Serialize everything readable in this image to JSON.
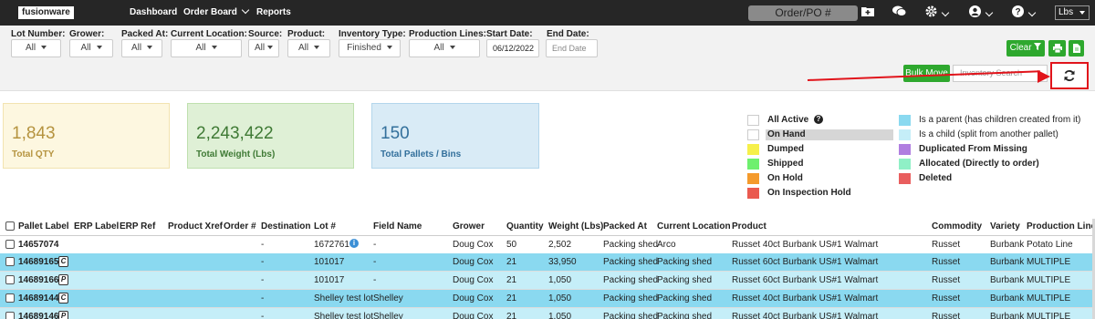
{
  "nav": {
    "logo": "fusionware",
    "links": [
      "Dashboard",
      "Order Board",
      "Reports"
    ],
    "order_po": "Order/PO #",
    "units": "Lbs"
  },
  "filters": {
    "lot_number": {
      "label": "Lot Number:",
      "value": "All"
    },
    "grower": {
      "label": "Grower:",
      "value": "All"
    },
    "packed_at": {
      "label": "Packed At:",
      "value": "All"
    },
    "current_location": {
      "label": "Current Location:",
      "value": "All"
    },
    "source": {
      "label": "Source:",
      "value": "All"
    },
    "product": {
      "label": "Product:",
      "value": "All"
    },
    "inventory_type": {
      "label": "Inventory Type:",
      "value": "Finished"
    },
    "production_lines": {
      "label": "Production Lines:",
      "value": "All"
    },
    "start_date": {
      "label": "Start Date:",
      "value": "06/12/2022"
    },
    "end_date": {
      "label": "End Date:",
      "placeholder": "End Date"
    },
    "clear": "Clear",
    "bulk_move": "Bulk Move",
    "search_placeholder": "Inventory Search"
  },
  "stats": [
    {
      "value": "1,843",
      "label": "Total QTY"
    },
    {
      "value": "2,243,422",
      "label": "Total Weight (Lbs)"
    },
    {
      "value": "150",
      "label": "Total Pallets / Bins"
    }
  ],
  "legend": {
    "left": [
      {
        "label": "All Active",
        "color": "#ffffff"
      },
      {
        "label": "On Hand",
        "color": "#ffffff"
      },
      {
        "label": "Dumped",
        "color": "#f6f04a"
      },
      {
        "label": "Shipped",
        "color": "#6ef06e"
      },
      {
        "label": "On Hold",
        "color": "#f49a2c"
      },
      {
        "label": "On Inspection Hold",
        "color": "#ea5a4f"
      }
    ],
    "right": [
      {
        "label": "Is a parent (has children created from it)",
        "color": "#8ad9f0"
      },
      {
        "label": "Is a child (split from another pallet)",
        "color": "#c5eef8"
      },
      {
        "label": "Duplicated From Missing",
        "color": "#b07ee0"
      },
      {
        "label": "Allocated (Directly to order)",
        "color": "#8ff0c6"
      },
      {
        "label": "Deleted",
        "color": "#e95e5e"
      }
    ]
  },
  "table": {
    "columns": [
      "Pallet Label",
      "ERP Label",
      "ERP Ref",
      "Product Xref",
      "Order #",
      "Destination",
      "Lot #",
      "Field Name",
      "Grower",
      "Quantity",
      "Weight (Lbs)",
      "Packed At",
      "Current Location",
      "Product",
      "Commodity",
      "Variety",
      "Production Line"
    ],
    "rows": [
      {
        "pallet": "14657074",
        "badge": "",
        "dest": "-",
        "lot": "1672761",
        "field": "-",
        "grower": "Doug Cox",
        "qty": "50",
        "weight": "2,502",
        "packed": "Packing shed",
        "location": "Arco",
        "product": "Russet 40ct Burbank US#1 Walmart",
        "commodity": "Russet",
        "variety": "Burbank",
        "line": "Potato Line",
        "color": "#ffffff"
      },
      {
        "pallet": "14689165",
        "badge": "C",
        "dest": "-",
        "lot": "101017",
        "field": "-",
        "grower": "Doug Cox",
        "qty": "21",
        "weight": "33,950",
        "packed": "Packing shed",
        "location": "Packing shed",
        "product": "Russet 60ct Burbank US#1 Walmart",
        "commodity": "Russet",
        "variety": "Burbank",
        "line": "MULTIPLE",
        "color": "#8ad9f0"
      },
      {
        "pallet": "14689166",
        "badge": "P",
        "dest": "-",
        "lot": "101017",
        "field": "-",
        "grower": "Doug Cox",
        "qty": "21",
        "weight": "1,050",
        "packed": "Packing shed",
        "location": "Packing shed",
        "product": "Russet 60ct Burbank US#1 Walmart",
        "commodity": "Russet",
        "variety": "Burbank",
        "line": "MULTIPLE",
        "color": "#c5eef8"
      },
      {
        "pallet": "14689144",
        "badge": "C",
        "dest": "-",
        "lot": "Shelley test lot",
        "field": "Shelley",
        "grower": "Doug Cox",
        "qty": "21",
        "weight": "1,050",
        "packed": "Packing shed",
        "location": "Packing shed",
        "product": "Russet 40ct Burbank US#1 Walmart",
        "commodity": "Russet",
        "variety": "Burbank",
        "line": "MULTIPLE",
        "color": "#8ad9f0"
      },
      {
        "pallet": "14689146",
        "badge": "P",
        "dest": "-",
        "lot": "Shelley test lot",
        "field": "Shelley",
        "grower": "Doug Cox",
        "qty": "21",
        "weight": "1,050",
        "packed": "Packing shed",
        "location": "Packing shed",
        "product": "Russet 40ct Burbank US#1 Walmart",
        "commodity": "Russet",
        "variety": "Burbank",
        "line": "MULTIPLE",
        "color": "#c5eef8"
      }
    ]
  }
}
